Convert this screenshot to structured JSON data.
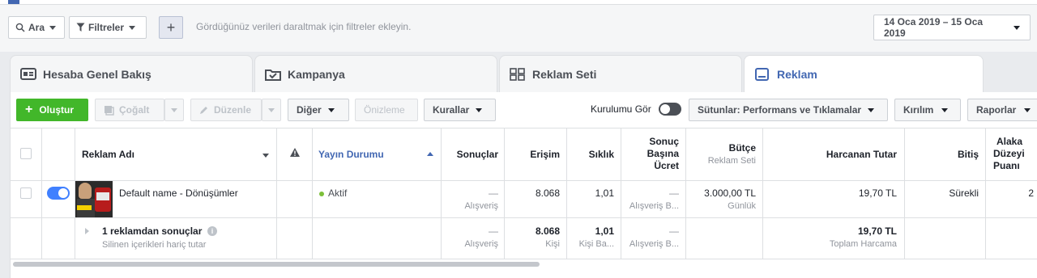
{
  "filter_bar": {
    "search_label": "Ara",
    "filters_label": "Filtreler",
    "add_filter_symbol": "+",
    "hint": "Gördüğünüz verileri daraltmak için filtreler ekleyin.",
    "date_range": "14 Oca 2019 – 15 Oca 2019"
  },
  "tabs": [
    {
      "label": "Hesaba Genel Bakış",
      "icon": "account-overview-icon"
    },
    {
      "label": "Kampanya",
      "icon": "campaign-folder-icon"
    },
    {
      "label": "Reklam Seti",
      "icon": "ad-set-grid-icon"
    },
    {
      "label": "Reklam",
      "icon": "ad-icon",
      "active": true
    }
  ],
  "toolbar": {
    "create": "Oluştur",
    "duplicate": "Çoğalt",
    "edit": "Düzenle",
    "more": "Diğer",
    "preview": "Önizleme",
    "rules": "Kurallar",
    "view_setup": "Kurulumu Gör",
    "columns": "Sütunlar: Performans ve Tıklamalar",
    "breakdown": "Kırılım",
    "reports": "Raporlar"
  },
  "table": {
    "headers": {
      "ad_name": "Reklam Adı",
      "delivery": "Yayın Durumu",
      "results": "Sonuçlar",
      "reach": "Erişim",
      "frequency": "Sıklık",
      "cost_per_result_1": "Sonuç",
      "cost_per_result_2": "Başına",
      "cost_per_result_3": "Ücret",
      "budget": "Bütçe",
      "budget_sub": "Reklam Seti",
      "amount_spent": "Harcanan Tutar",
      "ends": "Bitiş",
      "relevance_1": "Alaka",
      "relevance_2": "Düzeyi",
      "relevance_3": "Puanı"
    },
    "row": {
      "name": "Default name - Dönüşümler",
      "delivery": "Aktif",
      "results": "—",
      "results_sub": "Alışveriş",
      "reach": "8.068",
      "frequency": "1,01",
      "cost_per_result": "—",
      "cost_per_result_sub": "Alışveriş B...",
      "budget": "3.000,00 TL",
      "budget_sub": "Günlük",
      "amount_spent": "19,70 TL",
      "ends": "Sürekli",
      "relevance": "2"
    },
    "summary": {
      "title": "1 reklamdan sonuçlar",
      "subtitle": "Silinen içerikleri hariç tutar",
      "results": "—",
      "results_sub": "Alışveriş",
      "reach": "8.068",
      "reach_sub": "Kişi",
      "frequency": "1,01",
      "frequency_sub": "Kişi Ba...",
      "cost_per_result": "—",
      "cost_per_result_sub": "Alışveriş B...",
      "amount_spent": "19,70 TL",
      "amount_spent_sub": "Toplam Harcama"
    }
  },
  "colors": {
    "brand_blue": "#4267b2",
    "create_green": "#42b72a",
    "active_dot": "#7cbf3a",
    "toggle_on": "#4080ff"
  }
}
